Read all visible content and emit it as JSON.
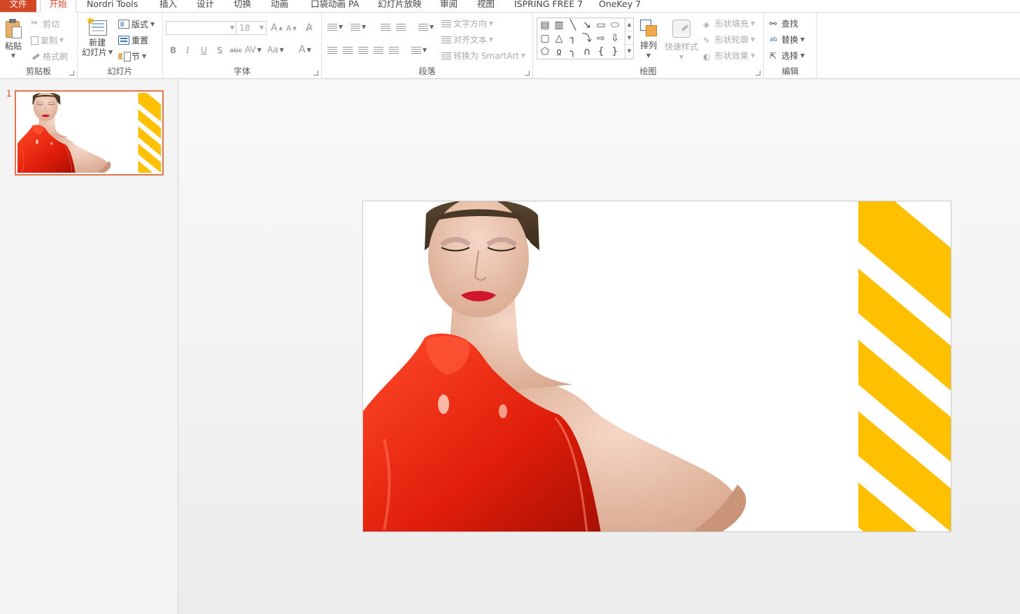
{
  "tabs": {
    "file": "文件",
    "home": "开始",
    "nordri": "Nordri Tools",
    "insert": "插入",
    "design": "设计",
    "transitions": "切换",
    "animations": "动画",
    "pocket": "口袋动画 PA",
    "slideshow": "幻灯片放映",
    "review": "审阅",
    "view": "视图",
    "ispring": "ISPRING FREE 7",
    "onekey": "OneKey 7"
  },
  "clipboard": {
    "paste": "粘贴",
    "cut": "剪切",
    "copy": "复制",
    "format_painter": "格式刷",
    "label": "剪贴板"
  },
  "slides_group": {
    "new_slide_line1": "新建",
    "new_slide_line2": "幻灯片",
    "layout": "版式",
    "reset": "重置",
    "section": "节",
    "label": "幻灯片"
  },
  "font_group": {
    "font_name": "",
    "font_size": "18",
    "grow": "A",
    "shrink": "A",
    "bold": "B",
    "italic": "I",
    "underline": "U",
    "shadow": "S",
    "strike": "abc",
    "spacing": "AV",
    "case": "Aa",
    "color": "A",
    "label": "字体"
  },
  "paragraph_group": {
    "text_direction": "文字方向",
    "align_text": "对齐文本",
    "smartart": "转换为 SmartArt",
    "label": "段落"
  },
  "drawing_group": {
    "arrange": "排列",
    "quick_styles": "快速样式",
    "shape_fill": "形状填充",
    "shape_outline": "形状轮廓",
    "shape_effects": "形状效果",
    "label": "绘图"
  },
  "editing_group": {
    "find": "查找",
    "replace": "替换",
    "select": "选择",
    "label": "编辑"
  },
  "thumbnails": [
    {
      "number": "1"
    }
  ],
  "colors": {
    "accent": "#d24726",
    "stripe": "#ffc000",
    "selection": "#e3744d",
    "dress": "#e8200c"
  },
  "slide": {
    "content": "portrait-photo-with-yellow-diagonal-stripes"
  }
}
